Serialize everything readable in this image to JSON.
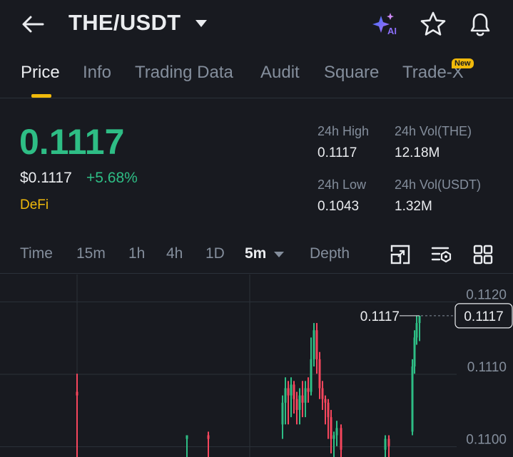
{
  "header": {
    "pair": "THE/USDT",
    "ai_badge": "AI"
  },
  "tabs": [
    {
      "label": "Price",
      "active": true
    },
    {
      "label": "Info",
      "active": false
    },
    {
      "label": "Trading Data",
      "active": false
    },
    {
      "label": "Audit",
      "active": false
    },
    {
      "label": "Square",
      "active": false
    },
    {
      "label": "Trade-X",
      "active": false
    }
  ],
  "new_badge": "New",
  "ticker": {
    "last_price": "0.1117",
    "usd_price": "$0.1117",
    "change": "+5.68%",
    "category": "DeFi"
  },
  "stats": {
    "high_label": "24h High",
    "high_value": "0.1117",
    "vol_base_label": "24h Vol(THE)",
    "vol_base_value": "12.18M",
    "low_label": "24h Low",
    "low_value": "0.1043",
    "vol_quote_label": "24h Vol(USDT)",
    "vol_quote_value": "1.32M"
  },
  "intervals": {
    "time": "Time",
    "i15m": "15m",
    "i1h": "1h",
    "i4h": "4h",
    "i1d": "1D",
    "selected": "5m",
    "depth": "Depth"
  },
  "icons": {
    "back": "arrow-left-icon",
    "dropdown": "caret-down-icon",
    "ai": "ai-sparkle-icon",
    "favorite": "star-icon",
    "alert": "bell-icon",
    "fullscreen": "expand-icon",
    "indicators": "indicator-settings-icon",
    "layout": "grid-icon"
  },
  "colors": {
    "background": "#181a20",
    "up": "#2ebd85",
    "down": "#f6465d",
    "accent": "#f0b90b",
    "muted": "#848e9c",
    "text": "#eaecef"
  },
  "chart_data": {
    "type": "candlestick",
    "y_ticks": [
      "0.1120",
      "0.1110",
      "0.1100"
    ],
    "ylim": [
      0.10975,
      0.11227
    ],
    "current_price_label": "0.1117",
    "max_label": "0.1117",
    "candles": [
      {
        "open": 0.11065,
        "close": 0.1106,
        "high": 0.1109,
        "low": 0.1097
      },
      {
        "open": 0.11,
        "close": 0.11005,
        "high": 0.11005,
        "low": 0.1097
      },
      {
        "open": 0.11005,
        "close": 0.11,
        "high": 0.1101,
        "low": 0.1097
      },
      {
        "open": 0.1102,
        "close": 0.1105,
        "high": 0.1106,
        "low": 0.11
      },
      {
        "open": 0.1105,
        "close": 0.1107,
        "high": 0.11085,
        "low": 0.1102
      },
      {
        "open": 0.1107,
        "close": 0.1106,
        "high": 0.1108,
        "low": 0.1102
      },
      {
        "open": 0.1106,
        "close": 0.11075,
        "high": 0.11085,
        "low": 0.1103
      },
      {
        "open": 0.11075,
        "close": 0.11055,
        "high": 0.1108,
        "low": 0.11035
      },
      {
        "open": 0.11055,
        "close": 0.1104,
        "high": 0.11065,
        "low": 0.1102
      },
      {
        "open": 0.1104,
        "close": 0.1106,
        "high": 0.1107,
        "low": 0.1102
      },
      {
        "open": 0.1106,
        "close": 0.1105,
        "high": 0.1108,
        "low": 0.1103
      },
      {
        "open": 0.1105,
        "close": 0.1107,
        "high": 0.1108,
        "low": 0.1103
      },
      {
        "open": 0.1107,
        "close": 0.11065,
        "high": 0.11085,
        "low": 0.1105
      },
      {
        "open": 0.11065,
        "close": 0.1111,
        "high": 0.1114,
        "low": 0.1106
      },
      {
        "open": 0.1111,
        "close": 0.1115,
        "high": 0.1116,
        "low": 0.111
      },
      {
        "open": 0.1115,
        "close": 0.1111,
        "high": 0.1116,
        "low": 0.1109
      },
      {
        "open": 0.1111,
        "close": 0.1107,
        "high": 0.1112,
        "low": 0.11055
      },
      {
        "open": 0.1107,
        "close": 0.11055,
        "high": 0.1108,
        "low": 0.1104
      },
      {
        "open": 0.11055,
        "close": 0.1105,
        "high": 0.1106,
        "low": 0.1102
      },
      {
        "open": 0.1105,
        "close": 0.1103,
        "high": 0.11055,
        "low": 0.11
      },
      {
        "open": 0.1103,
        "close": 0.11,
        "high": 0.1104,
        "low": 0.1098
      },
      {
        "open": 0.11,
        "close": 0.11005,
        "high": 0.1101,
        "low": 0.1097
      },
      {
        "open": 0.11005,
        "close": 0.11015,
        "high": 0.11025,
        "low": 0.1099
      },
      {
        "open": 0.11015,
        "close": 0.10985,
        "high": 0.1102,
        "low": 0.1097
      },
      {
        "open": 0.10985,
        "close": 0.11,
        "high": 0.11005,
        "low": 0.1097
      },
      {
        "open": 0.11,
        "close": 0.1099,
        "high": 0.11005,
        "low": 0.1097
      },
      {
        "open": 0.1101,
        "close": 0.111,
        "high": 0.1111,
        "low": 0.11005
      },
      {
        "open": 0.111,
        "close": 0.1114,
        "high": 0.1115,
        "low": 0.1109
      },
      {
        "open": 0.1114,
        "close": 0.1116,
        "high": 0.1117,
        "low": 0.1113
      },
      {
        "open": 0.1116,
        "close": 0.1117,
        "high": 0.1117,
        "low": 0.11135
      }
    ]
  }
}
